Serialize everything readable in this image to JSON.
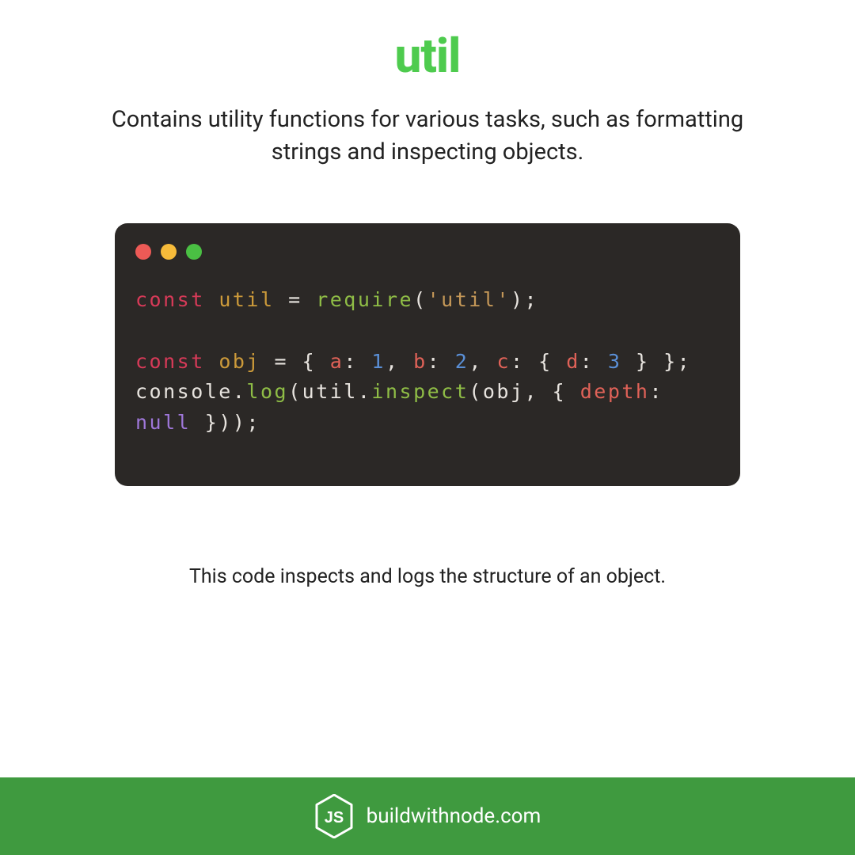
{
  "title": "util",
  "subtitle": "Contains utility functions for various tasks, such as formatting strings and inspecting objects.",
  "caption": "This code inspects and logs the structure of an object.",
  "footer": {
    "site": "buildwithnode.com"
  },
  "code": {
    "tokens": [
      [
        {
          "t": "const",
          "c": "kw"
        },
        {
          "t": " ",
          "c": "punc"
        },
        {
          "t": "util",
          "c": "var"
        },
        {
          "t": " = ",
          "c": "punc"
        },
        {
          "t": "require",
          "c": "fn"
        },
        {
          "t": "(",
          "c": "punc"
        },
        {
          "t": "'util'",
          "c": "str"
        },
        {
          "t": ");",
          "c": "punc"
        }
      ],
      [],
      [
        {
          "t": "const",
          "c": "kw"
        },
        {
          "t": " ",
          "c": "punc"
        },
        {
          "t": "obj",
          "c": "var"
        },
        {
          "t": " = { ",
          "c": "punc"
        },
        {
          "t": "a",
          "c": "prop"
        },
        {
          "t": ": ",
          "c": "punc"
        },
        {
          "t": "1",
          "c": "num"
        },
        {
          "t": ", ",
          "c": "punc"
        },
        {
          "t": "b",
          "c": "prop"
        },
        {
          "t": ": ",
          "c": "punc"
        },
        {
          "t": "2",
          "c": "num"
        },
        {
          "t": ", ",
          "c": "punc"
        },
        {
          "t": "c",
          "c": "prop"
        },
        {
          "t": ": { ",
          "c": "punc"
        },
        {
          "t": "d",
          "c": "prop"
        },
        {
          "t": ": ",
          "c": "punc"
        },
        {
          "t": "3",
          "c": "num"
        },
        {
          "t": " } };",
          "c": "punc"
        }
      ],
      [
        {
          "t": "console",
          "c": "punc"
        },
        {
          "t": ".",
          "c": "punc"
        },
        {
          "t": "log",
          "c": "fn"
        },
        {
          "t": "(",
          "c": "punc"
        },
        {
          "t": "util",
          "c": "punc"
        },
        {
          "t": ".",
          "c": "punc"
        },
        {
          "t": "inspect",
          "c": "fn"
        },
        {
          "t": "(",
          "c": "punc"
        },
        {
          "t": "obj",
          "c": "punc"
        },
        {
          "t": ", { ",
          "c": "punc"
        },
        {
          "t": "depth",
          "c": "prop"
        },
        {
          "t": ": ",
          "c": "punc"
        },
        {
          "t": "null",
          "c": "null"
        },
        {
          "t": " }));",
          "c": "punc"
        }
      ]
    ]
  }
}
